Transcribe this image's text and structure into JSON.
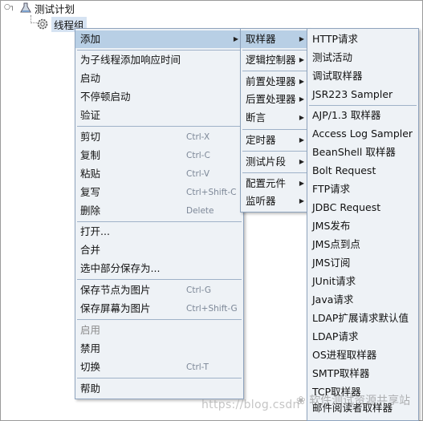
{
  "tree": {
    "root_label": "测试计划",
    "child_label": "线程组"
  },
  "menu1": {
    "items": [
      {
        "label": "添加"
      },
      {
        "label": "为子线程添加响应时间"
      },
      {
        "label": "启动"
      },
      {
        "label": "不停顿启动"
      },
      {
        "label": "验证"
      },
      {
        "label": "剪切",
        "shortcut": "Ctrl-X"
      },
      {
        "label": "复制",
        "shortcut": "Ctrl-C"
      },
      {
        "label": "粘贴",
        "shortcut": "Ctrl-V"
      },
      {
        "label": "复写",
        "shortcut": "Ctrl+Shift-C"
      },
      {
        "label": "删除",
        "shortcut": "Delete"
      },
      {
        "label": "打开..."
      },
      {
        "label": "合并"
      },
      {
        "label": "选中部分保存为..."
      },
      {
        "label": "保存节点为图片",
        "shortcut": "Ctrl-G"
      },
      {
        "label": "保存屏幕为图片",
        "shortcut": "Ctrl+Shift-G"
      },
      {
        "label": "启用"
      },
      {
        "label": "禁用"
      },
      {
        "label": "切换",
        "shortcut": "Ctrl-T"
      },
      {
        "label": "帮助"
      }
    ]
  },
  "menu2": {
    "items": [
      {
        "label": "取样器"
      },
      {
        "label": "逻辑控制器"
      },
      {
        "label": "前置处理器"
      },
      {
        "label": "后置处理器"
      },
      {
        "label": "断言"
      },
      {
        "label": "定时器"
      },
      {
        "label": "测试片段"
      },
      {
        "label": "配置元件"
      },
      {
        "label": "监听器"
      }
    ]
  },
  "menu3": {
    "items": [
      {
        "label": "HTTP请求"
      },
      {
        "label": "测试活动"
      },
      {
        "label": "调试取样器"
      },
      {
        "label": "JSR223 Sampler"
      },
      {
        "label": "AJP/1.3 取样器"
      },
      {
        "label": "Access Log Sampler"
      },
      {
        "label": "BeanShell 取样器"
      },
      {
        "label": "Bolt Request"
      },
      {
        "label": "FTP请求"
      },
      {
        "label": "JDBC Request"
      },
      {
        "label": "JMS发布"
      },
      {
        "label": "JMS点到点"
      },
      {
        "label": "JMS订阅"
      },
      {
        "label": "JUnit请求"
      },
      {
        "label": "Java请求"
      },
      {
        "label": "LDAP扩展请求默认值"
      },
      {
        "label": "LDAP请求"
      },
      {
        "label": "OS进程取样器"
      },
      {
        "label": "SMTP取样器"
      },
      {
        "label": "TCP取样器"
      },
      {
        "label": "邮件阅读者取样器"
      }
    ]
  },
  "watermark": {
    "left_text": "https://blog.csdn",
    "right_text": "软件测试资源共享站"
  },
  "colors": {
    "menu_bg": "#eef2f6",
    "highlight": "#b8cfe5",
    "separator": "#9fb2c8",
    "shortcut": "#7c8797"
  }
}
